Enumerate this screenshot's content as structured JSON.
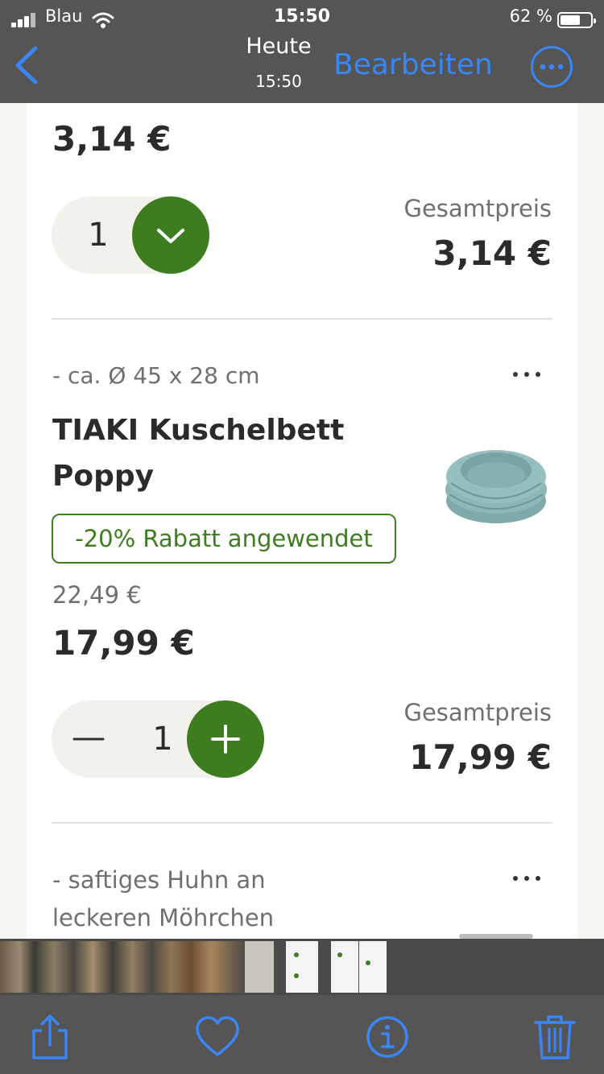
{
  "status_bar": {
    "carrier": "Blau",
    "time": "15:50",
    "battery_percent": "62 %",
    "battery_level": 0.62
  },
  "nav": {
    "title": "Heute",
    "subtitle": "15:50",
    "edit_label": "Bearbeiten",
    "back_icon": "chevron-left-icon",
    "more_icon": "ellipsis-circle-icon"
  },
  "item1": {
    "price": "3,14 €",
    "quantity": "1",
    "total_label": "Gesamtpreis",
    "total": "3,14 €"
  },
  "item2": {
    "detail": "- ca. Ø 45 x 28 cm",
    "name_line1": "TIAKI Kuschelbett",
    "name_line2": "Poppy",
    "discount_badge": "-20% Rabatt angewendet",
    "old_price": "22,49 €",
    "price": "17,99 €",
    "quantity": "1",
    "total_label": "Gesamtpreis",
    "total": "17,99 €"
  },
  "item3": {
    "detail_line1": "- saftiges Huhn an",
    "detail_line2": "leckeren Möhrchen"
  },
  "colors": {
    "accent_green": "#3e7c20",
    "ios_blue": "#3a86f5",
    "bar_gray": "#555555"
  },
  "toolbar": {
    "icons": [
      "share-icon",
      "heart-icon",
      "info-icon",
      "trash-icon"
    ]
  }
}
